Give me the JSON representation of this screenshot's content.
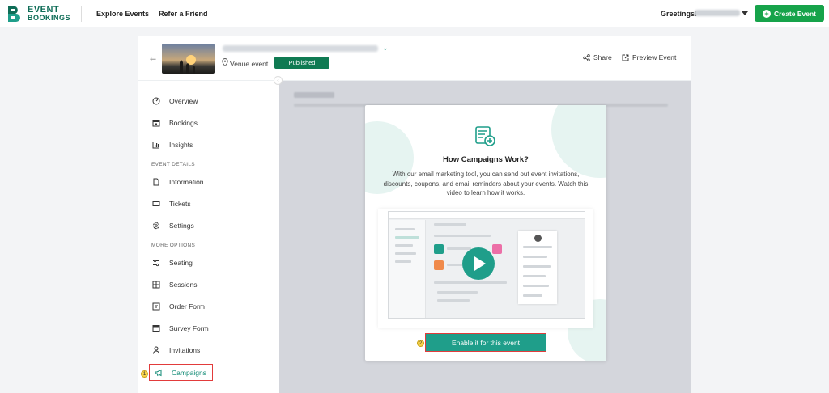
{
  "brand": {
    "line1": "EVENT",
    "line2": "BOOKINGS"
  },
  "topnav": {
    "links": [
      "Explore Events",
      "Refer a Friend"
    ],
    "greeting": "Greetings!",
    "create_label": "Create Event"
  },
  "event": {
    "venue_label": "Venue event",
    "status": "Published",
    "share_label": "Share",
    "preview_label": "Preview Event"
  },
  "sidebar": {
    "items": [
      {
        "label": "Overview",
        "icon": "gauge-icon"
      },
      {
        "label": "Bookings",
        "icon": "calendar-icon"
      },
      {
        "label": "Insights",
        "icon": "bar-chart-icon"
      }
    ],
    "section1": "EVENT DETAILS",
    "details": [
      {
        "label": "Information",
        "icon": "document-icon"
      },
      {
        "label": "Tickets",
        "icon": "ticket-icon"
      },
      {
        "label": "Settings",
        "icon": "gear-icon"
      }
    ],
    "section2": "MORE OPTIONS",
    "options": [
      {
        "label": "Seating",
        "icon": "sliders-icon"
      },
      {
        "label": "Sessions",
        "icon": "grid-icon"
      },
      {
        "label": "Order Form",
        "icon": "form-icon"
      },
      {
        "label": "Survey Form",
        "icon": "survey-icon"
      },
      {
        "label": "Invitations",
        "icon": "person-icon"
      },
      {
        "label": "Campaigns",
        "icon": "megaphone-icon"
      }
    ]
  },
  "modal": {
    "title": "How Campaigns Work?",
    "description": "With our email marketing tool, you can send out event invitations, discounts, coupons, and email reminders about your events. Watch this video to learn how it works.",
    "enable_label": "Enable it for this event"
  },
  "badges": {
    "step1": "1",
    "step2": "2"
  },
  "colors": {
    "accent": "#1f9e8a",
    "brand": "#0f6d57",
    "create": "#16a34a",
    "highlight": "#e23b3b"
  }
}
